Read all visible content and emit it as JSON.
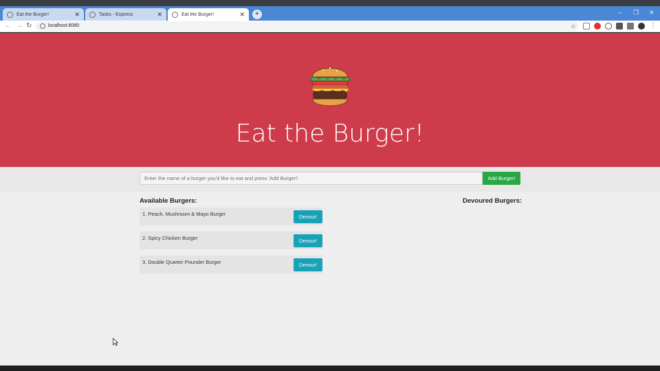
{
  "browser": {
    "tabs": [
      {
        "title": "Eat the Burger!",
        "active": false
      },
      {
        "title": "Tasks - Express",
        "active": false
      },
      {
        "title": "Eat the Burger!",
        "active": true
      }
    ],
    "url": "localhost:8080",
    "window_controls": {
      "minimize": "–",
      "restore": "❐",
      "close": "✕"
    }
  },
  "colors": {
    "hero_bg": "#ce3b4a",
    "add_button": "#28a745",
    "devour_button": "#17a2b8",
    "page_bg": "#eeeeee"
  },
  "header": {
    "logo_icon": "burger-icon",
    "title": "Eat the Burger!"
  },
  "form": {
    "placeholder": "Enter the name of a burger you'd like to eat and press 'Add Burger!'",
    "value": "",
    "submit_label": "Add Burger!"
  },
  "available": {
    "heading": "Available Burgers:",
    "devour_label": "Devour!",
    "items": [
      {
        "label": "1. Peach, Mushroom & Mayo Burger"
      },
      {
        "label": "2. Spicy Chicken Burger"
      },
      {
        "label": "3. Double Quarter Pounder Burger"
      }
    ]
  },
  "devoured": {
    "heading": "Devoured Burgers:",
    "items": []
  }
}
